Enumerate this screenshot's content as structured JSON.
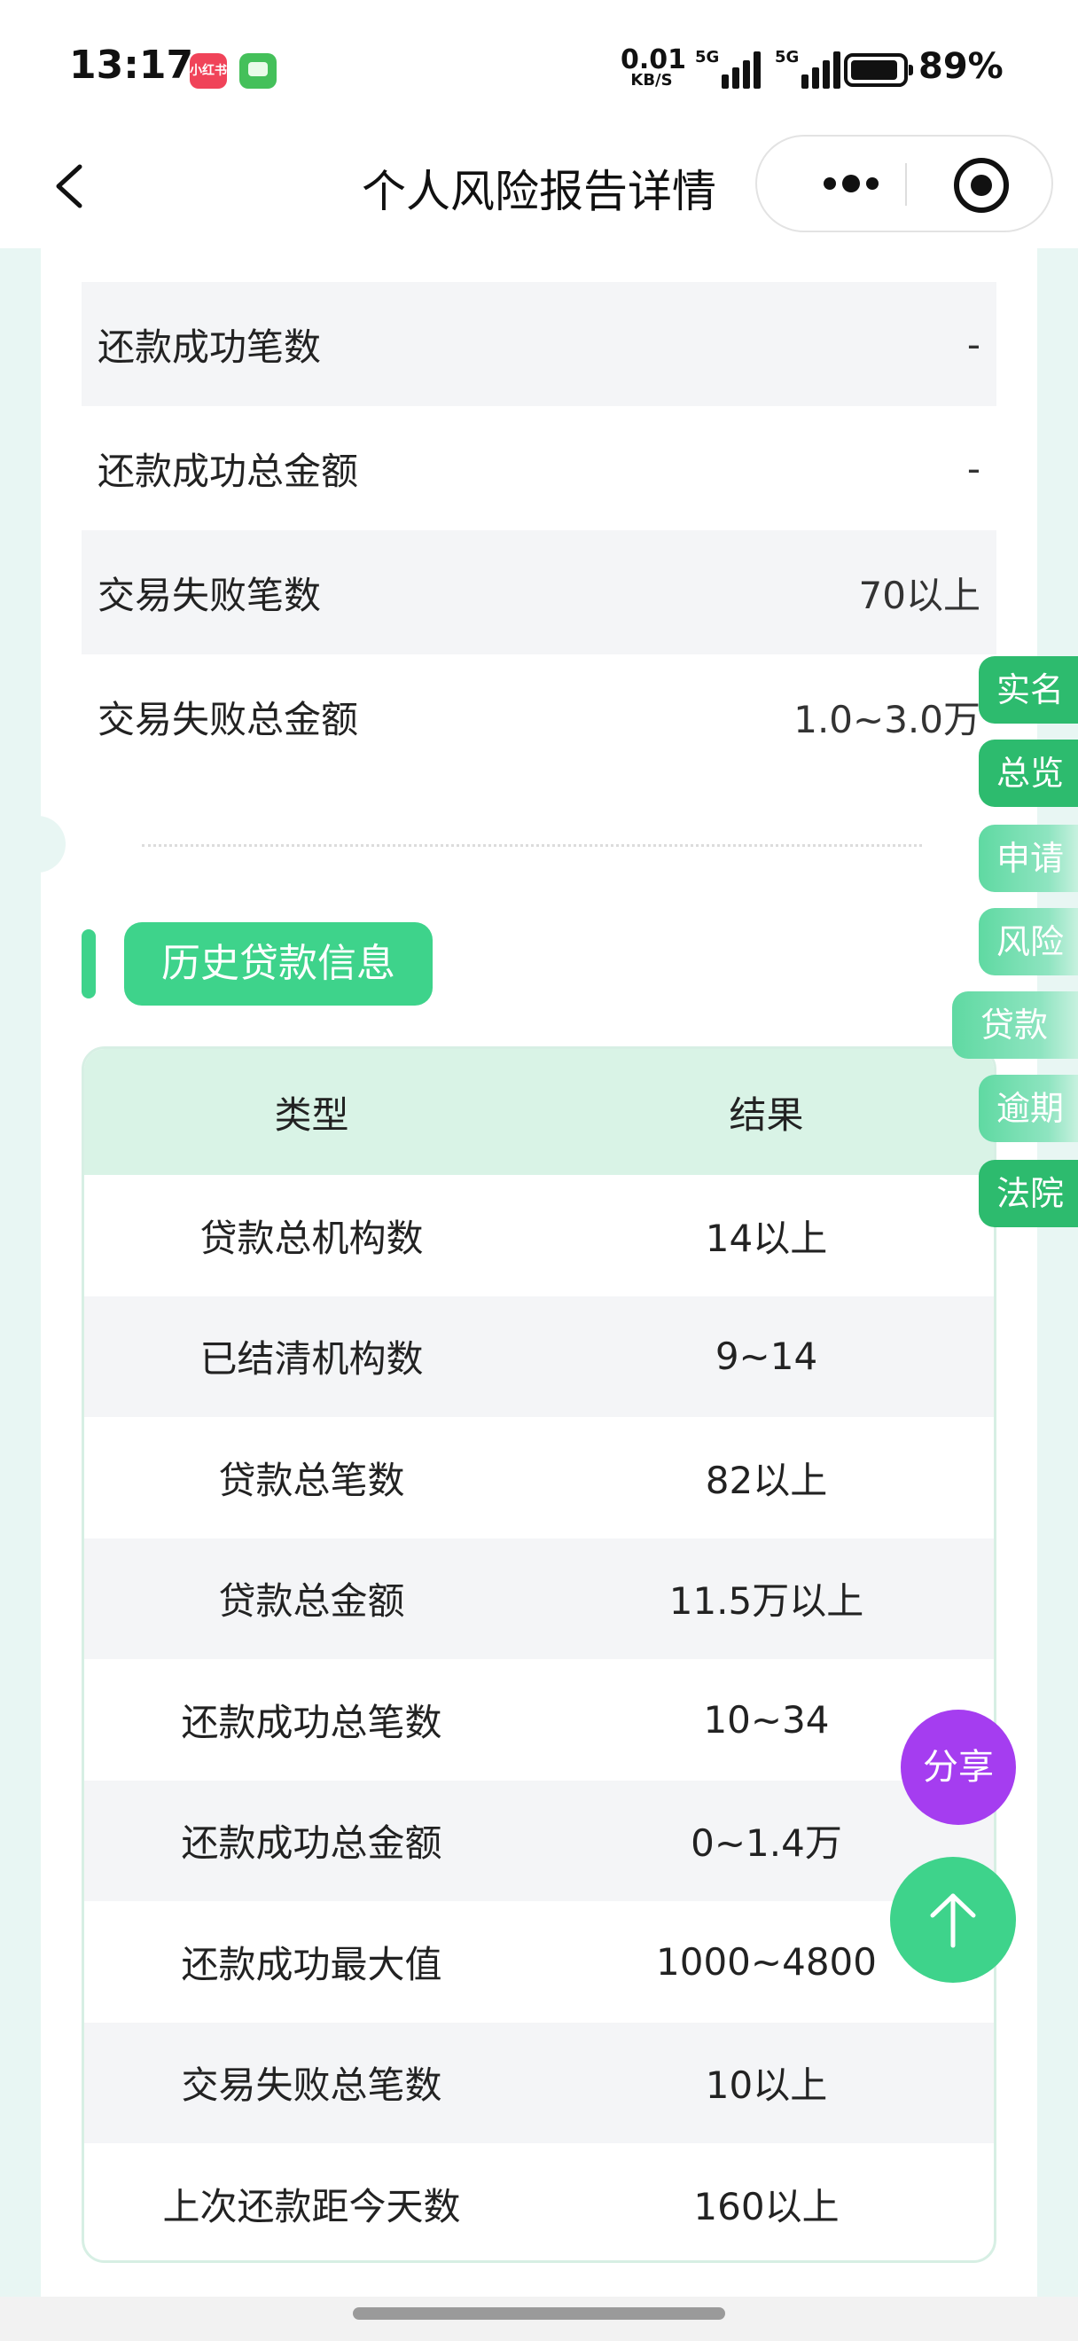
{
  "status_bar": {
    "time": "13:17",
    "app_badges": [
      "小红书"
    ],
    "net_speed_value": "0.01",
    "net_speed_unit": "KB/S",
    "signal_tags": [
      "5G",
      "5G"
    ],
    "battery": "89%"
  },
  "nav": {
    "title": "个人风险报告详情"
  },
  "top_table": {
    "rows": [
      {
        "label": "还款成功笔数",
        "value": "-"
      },
      {
        "label": "还款成功总金额",
        "value": "-"
      },
      {
        "label": "交易失败笔数",
        "value": "70以上"
      },
      {
        "label": "交易失败总金额",
        "value": "1.0~3.0万"
      }
    ]
  },
  "section": {
    "title": "历史贷款信息"
  },
  "loan_table": {
    "headers": [
      "类型",
      "结果"
    ],
    "rows": [
      {
        "type": "贷款总机构数",
        "result": "14以上"
      },
      {
        "type": "已结清机构数",
        "result": "9~14"
      },
      {
        "type": "贷款总笔数",
        "result": "82以上"
      },
      {
        "type": "贷款总金额",
        "result": "11.5万以上"
      },
      {
        "type": "还款成功总笔数",
        "result": "10~34"
      },
      {
        "type": "还款成功总金额",
        "result": "0~1.4万"
      },
      {
        "type": "还款成功最大值",
        "result": "1000~4800"
      },
      {
        "type": "交易失败总笔数",
        "result": "10以上"
      },
      {
        "type": "上次还款距今天数",
        "result": "160以上"
      }
    ]
  },
  "side_nav": {
    "items": [
      "实名",
      "总览",
      "申请",
      "风险",
      "贷款",
      "逾期",
      "法院"
    ]
  },
  "actions": {
    "share_label": "分享"
  },
  "colors": {
    "accent": "#3ed38b",
    "side_active": "#2dbb6e",
    "share": "#a53df0",
    "header_bg": "#d9f3e6"
  }
}
